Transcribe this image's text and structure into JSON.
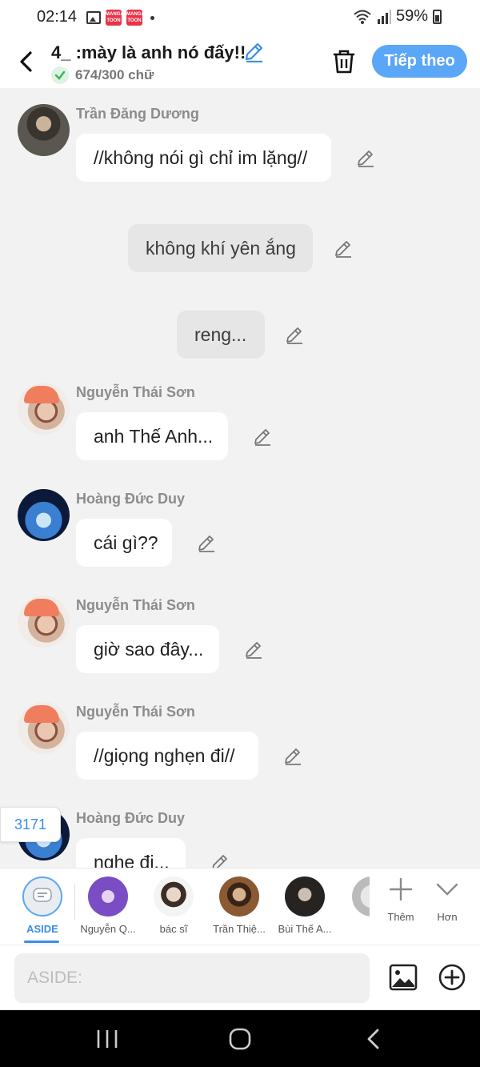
{
  "status_bar": {
    "time": "02:14",
    "battery": "59%",
    "app_badge": "MANGA TOON"
  },
  "header": {
    "title": "4_ :mày là anh nó đấy!!",
    "word_count": "674/300 chữ",
    "next_label": "Tiếp theo"
  },
  "messages": [
    {
      "sender": "Trần Đăng Dương",
      "text": "//không nói gì chỉ im lặng//"
    },
    {
      "text": "không khí yên ắng"
    },
    {
      "text": "reng..."
    },
    {
      "sender": "Nguyễn Thái Sơn",
      "text": "anh Thế Anh..."
    },
    {
      "sender": "Hoàng Đức Duy",
      "text": "cái gì??"
    },
    {
      "sender": "Nguyễn Thái Sơn",
      "text": "giờ sao đây..."
    },
    {
      "sender": "Nguyễn Thái Sơn",
      "text": "//giọng nghẹn đi//"
    },
    {
      "sender": "Hoàng Đức Duy",
      "text": "nghe đi..."
    }
  ],
  "count_badge": "3171",
  "characters": [
    {
      "label": "ASIDE"
    },
    {
      "label": "Nguyễn Q..."
    },
    {
      "label": "bác sĩ"
    },
    {
      "label": "Trần Thiệ..."
    },
    {
      "label": "Bùi Thế A..."
    }
  ],
  "tools": {
    "add_label": "Thêm",
    "more_label": "Hơn"
  },
  "input": {
    "placeholder": "ASIDE:"
  },
  "colors": {
    "accent": "#5aa6f7",
    "link": "#3a8ee6"
  }
}
